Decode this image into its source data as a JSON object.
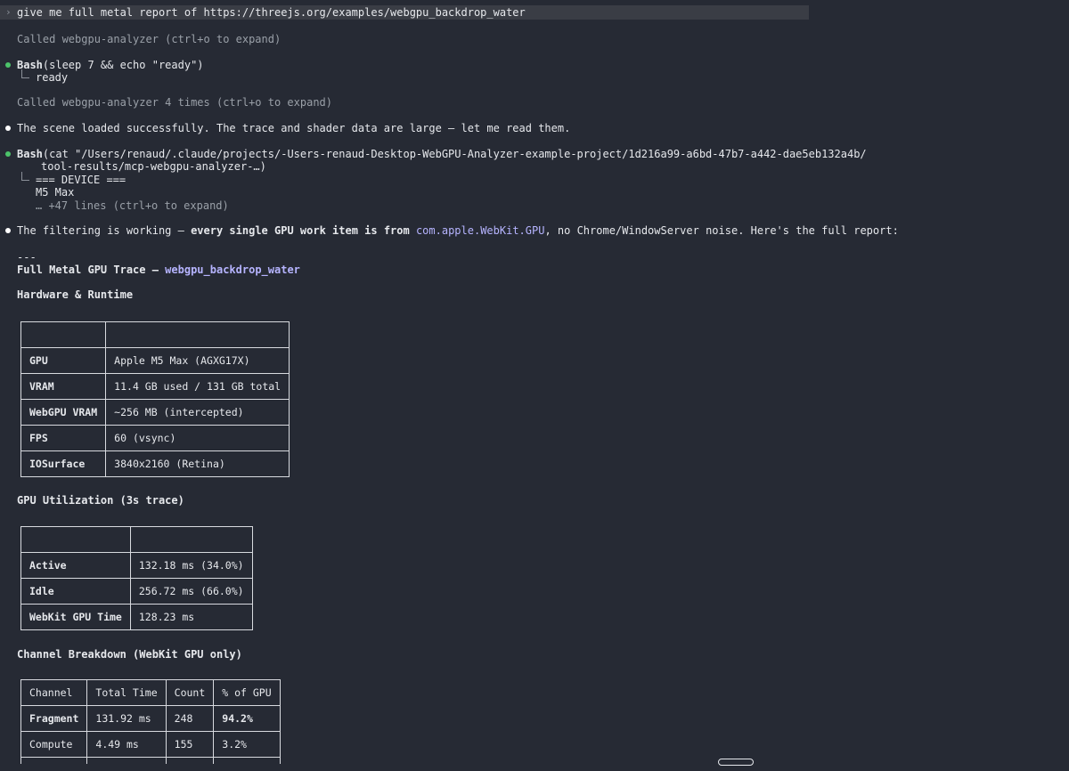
{
  "prompt": {
    "caret": "›",
    "text": "give me full metal report of https://threejs.org/examples/webgpu_backdrop_water"
  },
  "log": {
    "called_1": "Called webgpu-analyzer (ctrl+o to expand)",
    "bash_1_name": "Bash",
    "bash_1_args": "(sleep 7 && echo \"ready\")",
    "bash_1_output": "ready",
    "called_2": "Called webgpu-analyzer 4 times (ctrl+o to expand)",
    "message_1": "The scene loaded successfully. The trace and shader data are large — let me read them.",
    "bash_2_name": "Bash",
    "bash_2_args_line1": "(cat \"/Users/renaud/.claude/projects/-Users-renaud-Desktop-WebGPU-Analyzer-example-project/1d216a99-a6bd-47b7-a442-dae5eb132a4b/",
    "bash_2_args_line2": "tool-results/mcp-webgpu-analyzer-…)",
    "bash_2_out_1": "=== DEVICE ===",
    "bash_2_out_2": "M5 Max",
    "bash_2_out_3": "… +47 lines (ctrl+o to expand)",
    "message_2_part1": "The filtering is working — ",
    "message_2_bold": "every single GPU work item is from ",
    "message_2_link": "com.apple.WebKit.GPU",
    "message_2_part2": ", no Chrome/WindowServer noise. Here's the full report:"
  },
  "report": {
    "separator": "---",
    "title_prefix": "Full Metal GPU Trace — ",
    "title_link": "webgpu_backdrop_water",
    "hardware_heading": "Hardware & Runtime",
    "hardware_rows": [
      {
        "key": "GPU",
        "value": "Apple M5 Max (AGXG17X)"
      },
      {
        "key": "VRAM",
        "value": "11.4 GB used / 131 GB total"
      },
      {
        "key": "WebGPU VRAM",
        "value": "~256 MB (intercepted)"
      },
      {
        "key": "FPS",
        "value": "60 (vsync)"
      },
      {
        "key": "IOSurface",
        "value": "3840x2160 (Retina)"
      }
    ],
    "util_heading": "GPU Utilization (3s trace)",
    "util_rows": [
      {
        "key": "Active",
        "value": "132.18 ms (34.0%)"
      },
      {
        "key": "Idle",
        "value": "256.72 ms (66.0%)"
      },
      {
        "key": "WebKit GPU Time",
        "value": "128.23 ms"
      }
    ],
    "channel_heading": "Channel Breakdown (WebKit GPU only)",
    "channel_headers": [
      "Channel",
      "Total Time",
      "Count",
      "% of GPU"
    ],
    "channel_rows": [
      {
        "channel": "Fragment",
        "time": "131.92 ms",
        "count": "248",
        "pct": "94.2%"
      },
      {
        "channel": "Compute",
        "time": "4.49 ms",
        "count": "155",
        "pct": "3.2%"
      }
    ]
  }
}
